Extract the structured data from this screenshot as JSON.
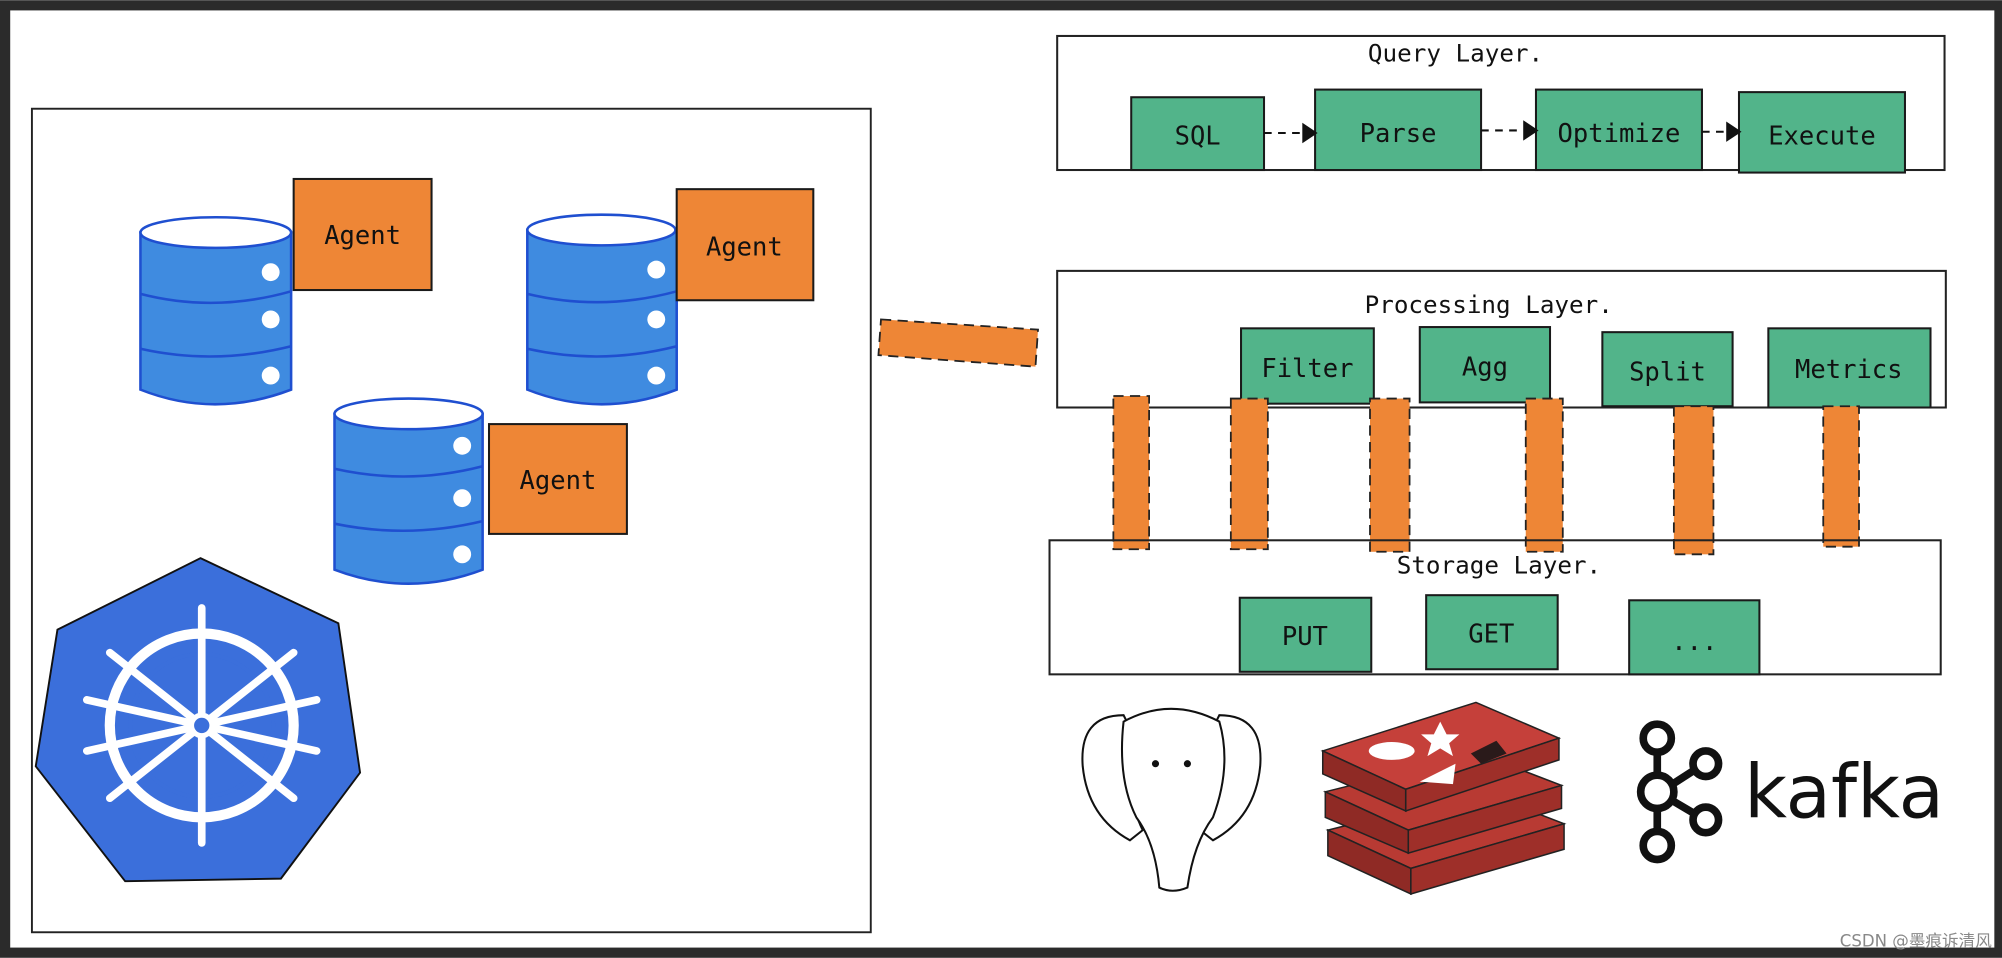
{
  "colors": {
    "green": "#52b48a",
    "orange": "#ee8636",
    "db_blue": "#3f8be0",
    "k8s_blue": "#3b6fdb",
    "redis_red": "#b83a33",
    "frame": "#2b2b2b"
  },
  "cluster": {
    "agents": [
      "Agent",
      "Agent",
      "Agent"
    ],
    "icons": [
      "database-icon",
      "database-icon",
      "database-icon",
      "kubernetes-icon"
    ]
  },
  "query_layer": {
    "title": "Query Layer.",
    "steps": [
      "SQL",
      "Parse",
      "Optimize",
      "Execute"
    ]
  },
  "processing_layer": {
    "title": "Processing Layer.",
    "items": [
      "Filter",
      "Agg",
      "Split",
      "Metrics"
    ]
  },
  "storage_layer": {
    "title": "Storage Layer.",
    "items": [
      "PUT",
      "GET",
      "..."
    ]
  },
  "backends": {
    "icons": [
      "postgresql-icon",
      "redis-icon",
      "kafka-icon"
    ],
    "kafka_label": "kafka"
  },
  "watermark": "CSDN @墨痕诉清风"
}
